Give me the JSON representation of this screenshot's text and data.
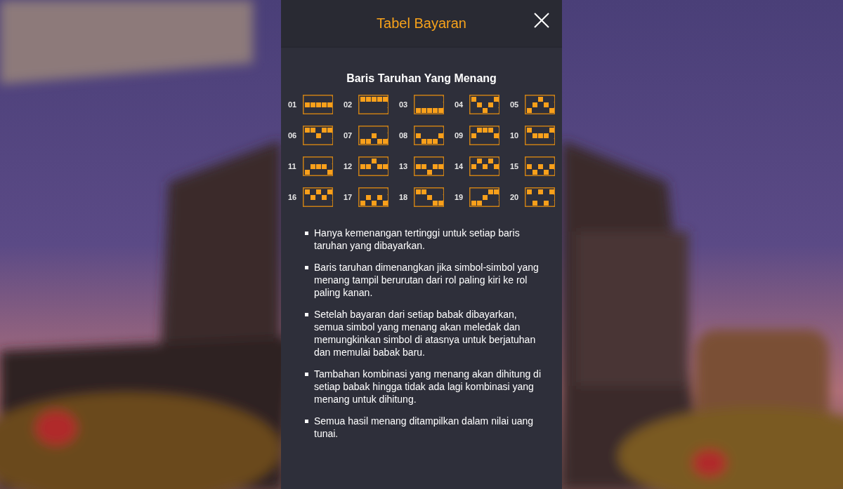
{
  "dialog": {
    "title": "Tabel Bayaran"
  },
  "section": {
    "heading": "Baris Taruhan Yang Menang"
  },
  "paylines": [
    {
      "number": "01",
      "cells": [
        [
          false,
          false,
          false,
          false,
          false
        ],
        [
          true,
          true,
          true,
          true,
          true
        ],
        [
          false,
          false,
          false,
          false,
          false
        ]
      ]
    },
    {
      "number": "02",
      "cells": [
        [
          true,
          true,
          true,
          true,
          true
        ],
        [
          false,
          false,
          false,
          false,
          false
        ],
        [
          false,
          false,
          false,
          false,
          false
        ]
      ]
    },
    {
      "number": "03",
      "cells": [
        [
          false,
          false,
          false,
          false,
          false
        ],
        [
          false,
          false,
          false,
          false,
          false
        ],
        [
          true,
          true,
          true,
          true,
          true
        ]
      ]
    },
    {
      "number": "04",
      "cells": [
        [
          true,
          false,
          false,
          false,
          true
        ],
        [
          false,
          true,
          false,
          true,
          false
        ],
        [
          false,
          false,
          true,
          false,
          false
        ]
      ]
    },
    {
      "number": "05",
      "cells": [
        [
          false,
          false,
          true,
          false,
          false
        ],
        [
          false,
          true,
          false,
          true,
          false
        ],
        [
          true,
          false,
          false,
          false,
          true
        ]
      ]
    },
    {
      "number": "06",
      "cells": [
        [
          true,
          true,
          false,
          true,
          true
        ],
        [
          false,
          false,
          true,
          false,
          false
        ],
        [
          false,
          false,
          false,
          false,
          false
        ]
      ]
    },
    {
      "number": "07",
      "cells": [
        [
          false,
          false,
          false,
          false,
          false
        ],
        [
          false,
          false,
          true,
          false,
          false
        ],
        [
          true,
          true,
          false,
          true,
          true
        ]
      ]
    },
    {
      "number": "08",
      "cells": [
        [
          false,
          false,
          false,
          false,
          false
        ],
        [
          true,
          false,
          false,
          false,
          true
        ],
        [
          false,
          true,
          true,
          true,
          false
        ]
      ]
    },
    {
      "number": "09",
      "cells": [
        [
          false,
          true,
          true,
          true,
          false
        ],
        [
          true,
          false,
          false,
          false,
          true
        ],
        [
          false,
          false,
          false,
          false,
          false
        ]
      ]
    },
    {
      "number": "10",
      "cells": [
        [
          true,
          false,
          false,
          false,
          true
        ],
        [
          false,
          true,
          true,
          true,
          false
        ],
        [
          false,
          false,
          false,
          false,
          false
        ]
      ]
    },
    {
      "number": "11",
      "cells": [
        [
          false,
          false,
          false,
          false,
          false
        ],
        [
          false,
          true,
          true,
          true,
          false
        ],
        [
          true,
          false,
          false,
          false,
          true
        ]
      ]
    },
    {
      "number": "12",
      "cells": [
        [
          false,
          false,
          true,
          false,
          false
        ],
        [
          true,
          true,
          false,
          true,
          true
        ],
        [
          false,
          false,
          false,
          false,
          false
        ]
      ]
    },
    {
      "number": "13",
      "cells": [
        [
          false,
          false,
          false,
          false,
          false
        ],
        [
          true,
          true,
          false,
          true,
          true
        ],
        [
          false,
          false,
          true,
          false,
          false
        ]
      ]
    },
    {
      "number": "14",
      "cells": [
        [
          false,
          true,
          false,
          true,
          false
        ],
        [
          true,
          false,
          true,
          false,
          true
        ],
        [
          false,
          false,
          false,
          false,
          false
        ]
      ]
    },
    {
      "number": "15",
      "cells": [
        [
          false,
          false,
          false,
          false,
          false
        ],
        [
          true,
          false,
          true,
          false,
          true
        ],
        [
          false,
          true,
          false,
          true,
          false
        ]
      ]
    },
    {
      "number": "16",
      "cells": [
        [
          true,
          false,
          true,
          false,
          true
        ],
        [
          false,
          true,
          false,
          true,
          false
        ],
        [
          false,
          false,
          false,
          false,
          false
        ]
      ]
    },
    {
      "number": "17",
      "cells": [
        [
          false,
          false,
          false,
          false,
          false
        ],
        [
          false,
          true,
          false,
          true,
          false
        ],
        [
          true,
          false,
          true,
          false,
          true
        ]
      ]
    },
    {
      "number": "18",
      "cells": [
        [
          true,
          true,
          false,
          false,
          false
        ],
        [
          false,
          false,
          true,
          false,
          false
        ],
        [
          false,
          false,
          false,
          true,
          true
        ]
      ]
    },
    {
      "number": "19",
      "cells": [
        [
          false,
          false,
          false,
          true,
          true
        ],
        [
          false,
          false,
          true,
          false,
          false
        ],
        [
          true,
          true,
          false,
          false,
          false
        ]
      ]
    },
    {
      "number": "20",
      "cells": [
        [
          true,
          false,
          true,
          false,
          true
        ],
        [
          false,
          false,
          false,
          false,
          false
        ],
        [
          false,
          true,
          false,
          true,
          false
        ]
      ]
    }
  ],
  "rules": [
    "Hanya kemenangan tertinggi untuk setiap baris taruhan yang dibayarkan.",
    "Baris taruhan dimenangkan jika simbol-simbol yang menang tampil berurutan dari rol paling kiri ke rol paling kanan.",
    "Setelah bayaran dari setiap babak dibayarkan, semua simbol yang menang akan meledak dan memungkinkan simbol di atasnya untuk berjatuhan dan memulai babak baru.",
    "Tambahan kombinasi yang menang akan dihitung di setiap babak hingga tidak ada lagi kombinasi yang menang untuk dihitung.",
    "Semua hasil menang ditampilkan dalam nilai uang tunai."
  ]
}
